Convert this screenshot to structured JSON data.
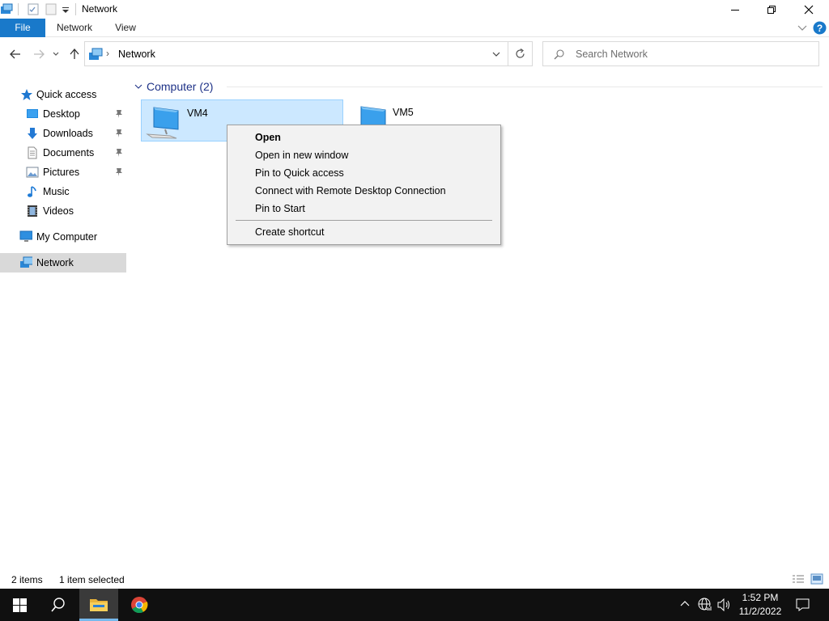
{
  "window": {
    "title": "Network"
  },
  "ribbon": {
    "tabs": [
      "File",
      "Network",
      "View"
    ]
  },
  "address": {
    "path": "Network",
    "search_placeholder": "Search Network"
  },
  "nav": {
    "quick_access": "Quick access",
    "items": [
      {
        "label": "Desktop",
        "pinned": true
      },
      {
        "label": "Downloads",
        "pinned": true
      },
      {
        "label": "Documents",
        "pinned": true
      },
      {
        "label": "Pictures",
        "pinned": true
      },
      {
        "label": "Music",
        "pinned": false
      },
      {
        "label": "Videos",
        "pinned": false
      }
    ],
    "my_computer": "My Computer",
    "network": "Network"
  },
  "content": {
    "group_header": "Computer (2)",
    "items": [
      {
        "label": "VM4",
        "selected": true
      },
      {
        "label": "VM5",
        "selected": false
      }
    ]
  },
  "context_menu": {
    "items": [
      "Open",
      "Open in new window",
      "Pin to Quick access",
      "Connect with Remote Desktop Connection",
      "Pin to Start",
      "Create shortcut"
    ]
  },
  "status": {
    "count": "2 items",
    "selection": "1 item selected"
  },
  "taskbar": {
    "time": "1:52 PM",
    "date": "11/2/2022"
  },
  "colors": {
    "accent": "#1979ca",
    "selection_bg": "#cce8ff",
    "nav_selected_bg": "#d9d9d9",
    "taskbar_bg": "#101010"
  }
}
